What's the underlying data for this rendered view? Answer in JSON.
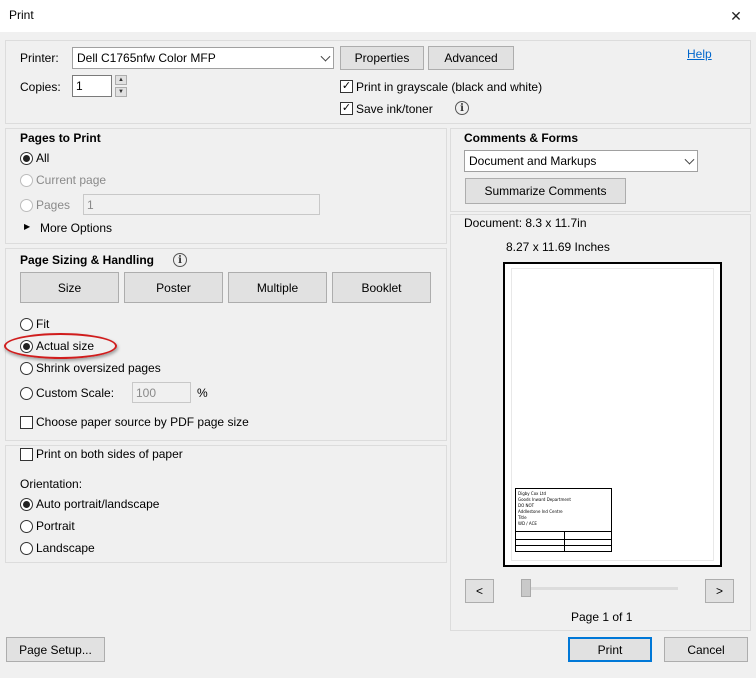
{
  "window": {
    "title": "Print"
  },
  "printer": {
    "label": "Printer:",
    "selected": "Dell C1765nfw Color MFP",
    "properties_label": "Properties",
    "advanced_label": "Advanced",
    "help_label": "Help",
    "copies_label": "Copies:",
    "copies_value": "1",
    "grayscale_label": "Print in grayscale (black and white)",
    "grayscale_checked": true,
    "save_ink_label": "Save ink/toner",
    "save_ink_checked": true
  },
  "pages_to_print": {
    "heading": "Pages to Print",
    "all_label": "All",
    "current_page_label": "Current page",
    "pages_label": "Pages",
    "pages_value": "1",
    "more_options_label": "More Options",
    "selected": "All"
  },
  "page_sizing": {
    "heading": "Page Sizing & Handling",
    "tabs": [
      "Size",
      "Poster",
      "Multiple",
      "Booklet"
    ],
    "fit_label": "Fit",
    "actual_size_label": "Actual size",
    "shrink_label": "Shrink oversized pages",
    "custom_scale_label": "Custom Scale:",
    "custom_scale_value": "100",
    "percent": "%",
    "paper_source_label": "Choose paper source by PDF page size",
    "selected": "Actual size"
  },
  "duplex": {
    "label": "Print on both sides of paper"
  },
  "orientation": {
    "heading": "Orientation:",
    "auto_label": "Auto portrait/landscape",
    "portrait_label": "Portrait",
    "landscape_label": "Landscape",
    "selected": "Auto portrait/landscape"
  },
  "comments_forms": {
    "heading": "Comments & Forms",
    "selected": "Document and Markups",
    "summarize_label": "Summarize Comments"
  },
  "preview": {
    "document_size": "Document: 8.3 x 11.7in",
    "page_size": "8.27 x 11.69 Inches",
    "prev_label": "<",
    "next_label": ">",
    "page_indicator": "Page 1 of 1",
    "slider_position": 0,
    "title_block": {
      "line1": "Digby Cox Ltd",
      "line2": "Goods Inward Department",
      "line3": "DO NOT",
      "line4": "Addlestone Ind Centre",
      "line5": "Title",
      "line6": "WD / ACE"
    }
  },
  "footer": {
    "page_setup_label": "Page Setup...",
    "print_label": "Print",
    "cancel_label": "Cancel"
  },
  "colors": {
    "dialog_bg": "#f0f0f0",
    "accent": "#0078d7",
    "annotation": "#d01c1c",
    "link": "#0066cc"
  }
}
